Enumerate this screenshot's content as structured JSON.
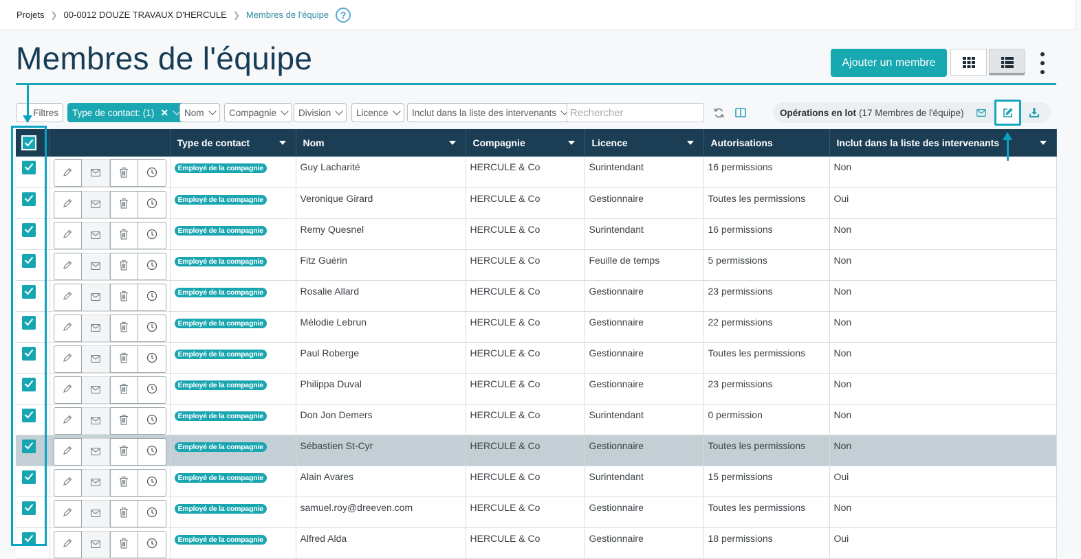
{
  "breadcrumb": [
    "Projets",
    "00-0012 DOUZE TRAVAUX D'HERCULE",
    "Membres de l'équipe"
  ],
  "help_icon": "?",
  "page_title": "Membres de l'équipe",
  "add_button": "Ajouter un membre",
  "filters": {
    "filters_label": "Filtres",
    "contact_type": "Type de contact: (1)",
    "nom": "Nom",
    "compagnie": "Compagnie",
    "division": "Division",
    "licence": "Licence",
    "intervenants": "Inclut dans la liste des intervenants",
    "search_placeholder": "Rechercher"
  },
  "batch": {
    "label": "Opérations en lot",
    "count": "(17 Membres de l'équipe)"
  },
  "table": {
    "headers": [
      "Type de contact",
      "Nom",
      "Compagnie",
      "Licence",
      "Autorisations",
      "Inclut dans la liste des intervenants"
    ],
    "rows": [
      {
        "type": "Employé de la compagnie",
        "nom": "Guy Lacharité",
        "compagnie": "HERCULE & Co",
        "licence": "Surintendant",
        "autorisations": "16 permissions",
        "intervenants": "Non"
      },
      {
        "type": "Employé de la compagnie",
        "nom": "Veronique Girard",
        "compagnie": "HERCULE & Co",
        "licence": "Gestionnaire",
        "autorisations": "Toutes les permissions",
        "intervenants": "Oui"
      },
      {
        "type": "Employé de la compagnie",
        "nom": "Remy Quesnel",
        "compagnie": "HERCULE & Co",
        "licence": "Surintendant",
        "autorisations": "16 permissions",
        "intervenants": "Non"
      },
      {
        "type": "Employé de la compagnie",
        "nom": "Fitz Guérin",
        "compagnie": "HERCULE & Co",
        "licence": "Feuille de temps",
        "autorisations": "5 permissions",
        "intervenants": "Non"
      },
      {
        "type": "Employé de la compagnie",
        "nom": "Rosalie Allard",
        "compagnie": "HERCULE & Co",
        "licence": "Gestionnaire",
        "autorisations": "23 permissions",
        "intervenants": "Non"
      },
      {
        "type": "Employé de la compagnie",
        "nom": "Mélodie Lebrun",
        "compagnie": "HERCULE & Co",
        "licence": "Gestionnaire",
        "autorisations": "22 permissions",
        "intervenants": "Non"
      },
      {
        "type": "Employé de la compagnie",
        "nom": "Paul Roberge",
        "compagnie": "HERCULE & Co",
        "licence": "Gestionnaire",
        "autorisations": "Toutes les permissions",
        "intervenants": "Non"
      },
      {
        "type": "Employé de la compagnie",
        "nom": "Philippa Duval",
        "compagnie": "HERCULE & Co",
        "licence": "Gestionnaire",
        "autorisations": "23 permissions",
        "intervenants": "Non"
      },
      {
        "type": "Employé de la compagnie",
        "nom": "Don Jon Demers",
        "compagnie": "HERCULE & Co",
        "licence": "Surintendant",
        "autorisations": "0 permission",
        "intervenants": "Non"
      },
      {
        "type": "Employé de la compagnie",
        "nom": "Sébastien St-Cyr",
        "compagnie": "HERCULE & Co",
        "licence": "Gestionnaire",
        "autorisations": "Toutes les permissions",
        "intervenants": "Non",
        "selected": true
      },
      {
        "type": "Employé de la compagnie",
        "nom": "Alain Avares",
        "compagnie": "HERCULE & Co",
        "licence": "Surintendant",
        "autorisations": "15 permissions",
        "intervenants": "Oui"
      },
      {
        "type": "Employé de la compagnie",
        "nom": "samuel.roy@dreeven.com",
        "compagnie": "HERCULE & Co",
        "licence": "Gestionnaire",
        "autorisations": "Toutes les permissions",
        "intervenants": "Non"
      },
      {
        "type": "Employé de la compagnie",
        "nom": "Alfred Alda",
        "compagnie": "HERCULE & Co",
        "licence": "Gestionnaire",
        "autorisations": "18 permissions",
        "intervenants": "Oui"
      }
    ]
  },
  "colors": {
    "accent": "#17a8b0",
    "header_bg": "#1b3e55",
    "title": "#173c55",
    "annotation": "#0aa3c6",
    "selected_row": "#c3ced5"
  },
  "icons": [
    "help-icon",
    "grid-view-icon",
    "list-view-icon",
    "more-vertical-icon",
    "refresh-icon",
    "columns-icon",
    "mail-icon",
    "edit-icon",
    "download-icon",
    "pencil-icon",
    "trash-icon",
    "clock-icon",
    "check-icon"
  ]
}
